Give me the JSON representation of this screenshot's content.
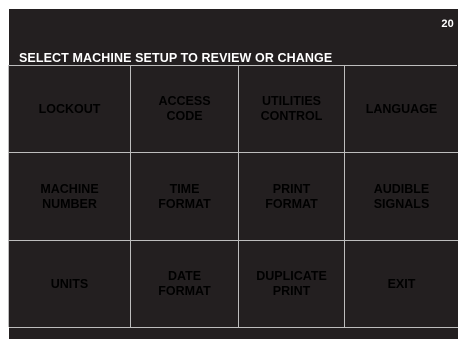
{
  "screen": {
    "number": "20",
    "prompt": "SELECT MACHINE SETUP TO REVIEW OR CHANGE"
  },
  "buttons": [
    {
      "label": "LOCKOUT"
    },
    {
      "label": "ACCESS\nCODE"
    },
    {
      "label": "UTILITIES\nCONTROL"
    },
    {
      "label": "LANGUAGE"
    },
    {
      "label": "MACHINE\nNUMBER"
    },
    {
      "label": "TIME\nFORMAT"
    },
    {
      "label": "PRINT\nFORMAT"
    },
    {
      "label": "AUDIBLE\nSIGNALS"
    },
    {
      "label": "UNITS"
    },
    {
      "label": "DATE\nFORMAT"
    },
    {
      "label": "DUPLICATE\nPRINT"
    },
    {
      "label": "EXIT"
    }
  ],
  "colors": {
    "screen_background": "#231f20",
    "text": "#ffffff",
    "grid_lines": "#bdbdbd"
  }
}
